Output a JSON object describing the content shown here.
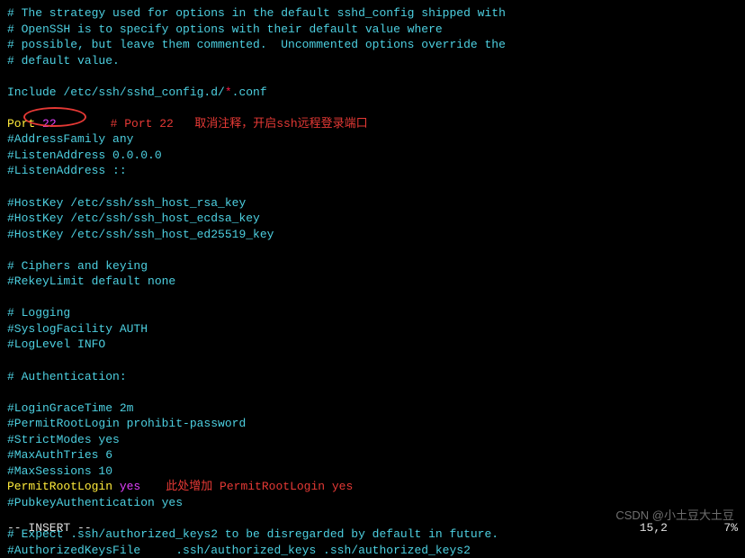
{
  "config": {
    "comment1": "# The strategy used for options in the default sshd_config shipped with",
    "comment2": "# OpenSSH is to specify options with their default value where",
    "comment3": "# possible, but leave them commented.  Uncommented options override the",
    "comment4": "# default value.",
    "include_prefix": "Include /etc/ssh/sshd_config.d/",
    "include_wildcard": "*",
    "include_suffix": ".conf",
    "port_key": "Port",
    "port_value": " 22",
    "addressfamily": "#AddressFamily any",
    "listen1": "#ListenAddress 0.0.0.0",
    "listen2": "#ListenAddress ::",
    "hostkey1": "#HostKey /etc/ssh/ssh_host_rsa_key",
    "hostkey2": "#HostKey /etc/ssh/ssh_host_ecdsa_key",
    "hostkey3": "#HostKey /etc/ssh/ssh_host_ed25519_key",
    "ciphers_comment": "# Ciphers and keying",
    "rekey": "#RekeyLimit default none",
    "logging_comment": "# Logging",
    "syslog": "#SyslogFacility AUTH",
    "loglevel": "#LogLevel INFO",
    "auth_comment": "# Authentication:",
    "logingrace": "#LoginGraceTime 2m",
    "permitroot_comment": "#PermitRootLogin prohibit-password",
    "strictmodes": "#StrictModes yes",
    "maxauth": "#MaxAuthTries 6",
    "maxsessions": "#MaxSessions 10",
    "permitroot_key": "PermitRootLogin",
    "permitroot_val": " yes",
    "pubkey": "#PubkeyAuthentication yes",
    "expect_comment": "# Expect .ssh/authorized_keys2 to be disregarded by default in future.",
    "authkeysfile": "#AuthorizedKeysFile     .ssh/authorized_keys .ssh/authorized_keys2"
  },
  "annotations": {
    "port_note": "# Port 22   取消注释，开启ssh远程登录端口",
    "permitroot_note": "此处增加 PermitRootLogin yes"
  },
  "status": {
    "mode": "-- INSERT --",
    "position": "15,2",
    "percent": "7%"
  },
  "watermark": "CSDN @小土豆大土豆"
}
